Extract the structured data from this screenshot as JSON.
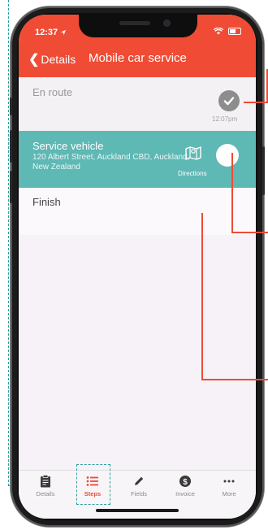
{
  "colors": {
    "header": "#ef4b35",
    "active_step": "#5eb8b4",
    "callout": "#ef4b35",
    "guide": "#2f9fa0"
  },
  "status_bar": {
    "time": "12:37",
    "location_icon": "location-arrow-icon",
    "wifi_icon": "wifi-icon",
    "battery_icon": "battery-icon"
  },
  "nav": {
    "back_label": "Details",
    "title": "Mobile car service"
  },
  "steps": [
    {
      "title": "En route",
      "status_icon": "checkmark-icon",
      "time": "12:07pm"
    },
    {
      "title": "Service vehicle",
      "address": "120 Albert Street, Auckland CBD, Auckland, New Zealand",
      "directions_label": "Directions",
      "directions_icon": "map-icon"
    },
    {
      "title": "Finish"
    }
  ],
  "tabs": [
    {
      "label": "Details",
      "icon": "clipboard-icon",
      "active": false
    },
    {
      "label": "Steps",
      "icon": "list-icon",
      "active": true
    },
    {
      "label": "Fields",
      "icon": "pencil-icon",
      "active": false
    },
    {
      "label": "Invoice",
      "icon": "dollar-circle-icon",
      "active": false
    },
    {
      "label": "More",
      "icon": "ellipsis-icon",
      "active": false
    }
  ]
}
